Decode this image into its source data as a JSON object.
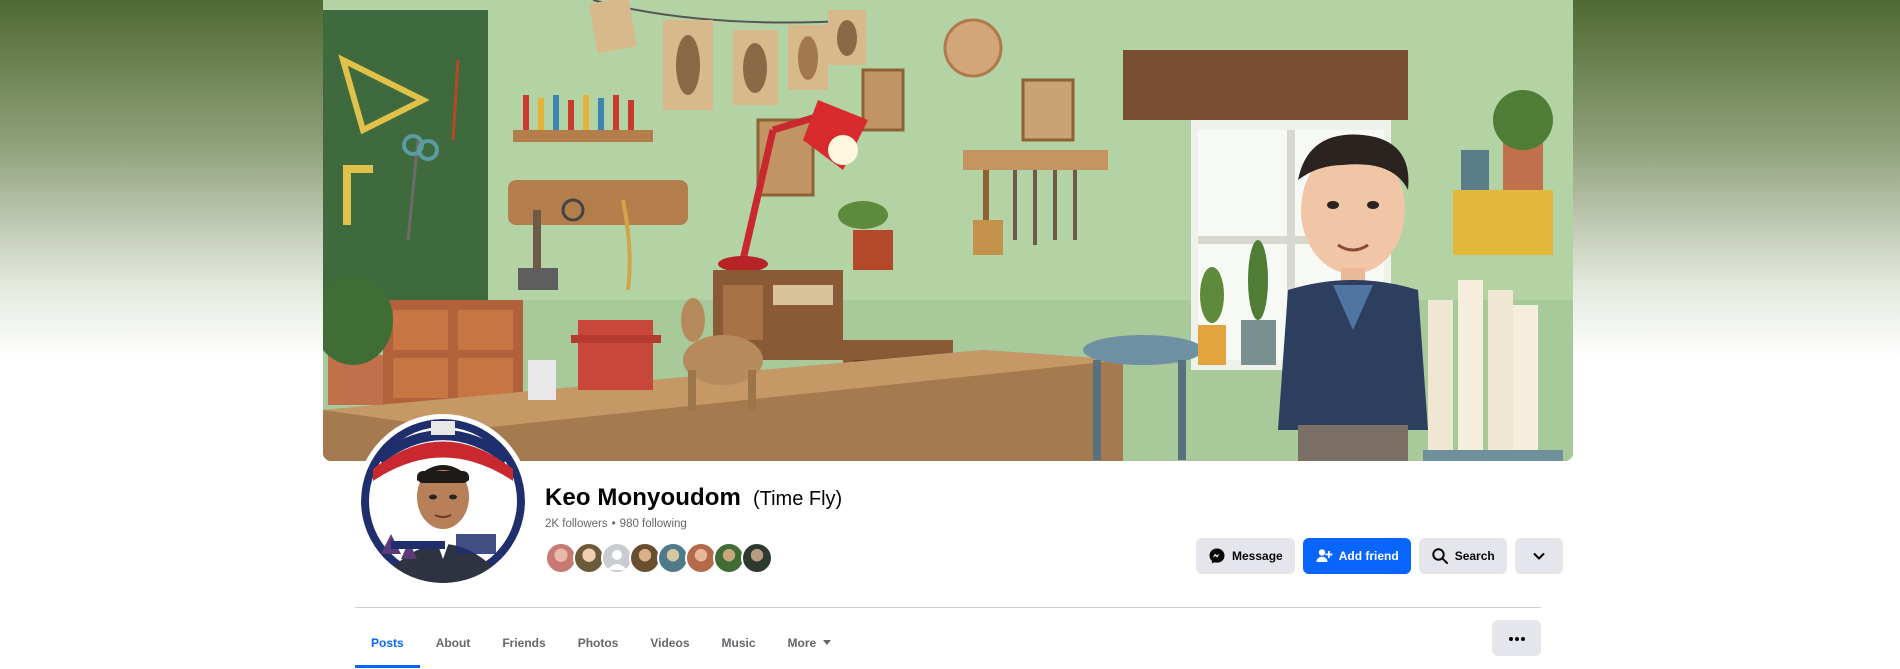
{
  "profile": {
    "name": "Keo Monyoudom",
    "alternate_name": "(Time Fly)",
    "followers": "2K followers",
    "separator": "•",
    "following": "980 following"
  },
  "actions": {
    "message_label": "Message",
    "add_friend_label": "Add friend",
    "search_label": "Search"
  },
  "tabs": [
    {
      "label": "Posts",
      "active": true
    },
    {
      "label": "About"
    },
    {
      "label": "Friends"
    },
    {
      "label": "Photos"
    },
    {
      "label": "Videos"
    },
    {
      "label": "Music"
    },
    {
      "label": "More"
    }
  ],
  "friend_avatars_count": 8,
  "colors": {
    "accent": "#0866ff",
    "button_bg": "#e4e6eb",
    "muted_text": "#65676b"
  },
  "icons": {
    "message": "messenger-icon",
    "add_friend": "add-friend-icon",
    "search": "search-icon",
    "dropdown": "chevron-down-icon",
    "more_tab": "caret-down-icon",
    "overflow": "more-dots-icon"
  }
}
